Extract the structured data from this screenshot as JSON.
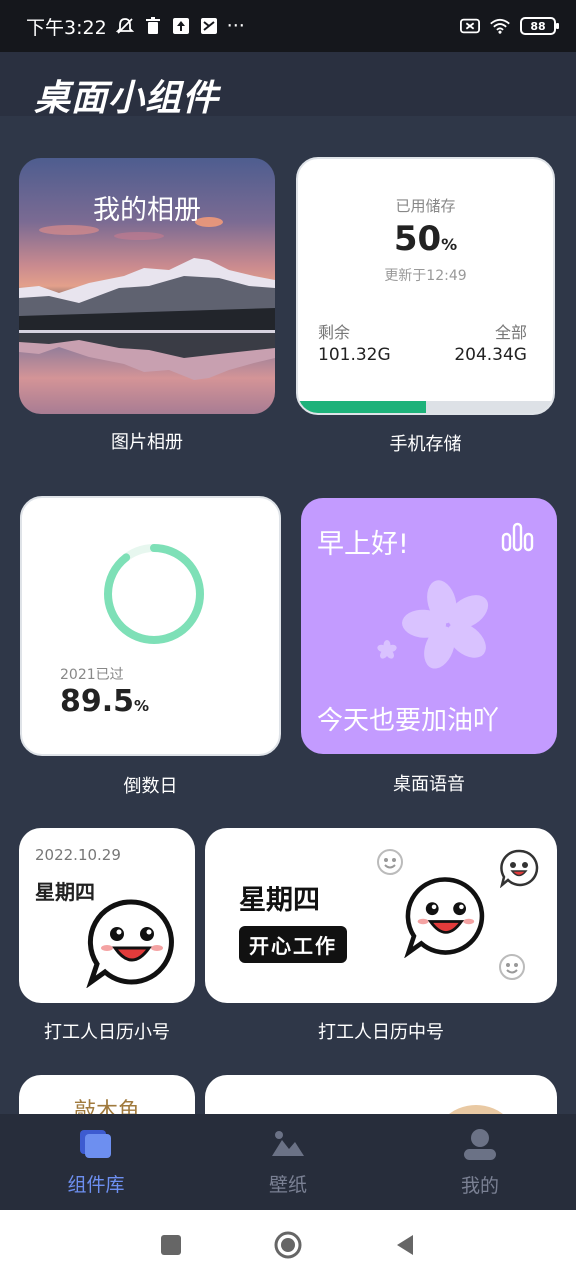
{
  "status_bar": {
    "time": "下午3:22",
    "overflow": "···",
    "battery": "88",
    "icons": [
      "silent-icon",
      "trash-icon",
      "upload-icon",
      "app-icon",
      "sim-off-icon",
      "wifi-icon",
      "battery-icon"
    ]
  },
  "header": {
    "title": "桌面小组件"
  },
  "widgets": {
    "album": {
      "title": "我的相册",
      "caption": "图片相册"
    },
    "storage": {
      "label": "已用储存",
      "percent": "50",
      "percent_unit": "%",
      "updated": "更新于12:49",
      "remaining_label": "剩余",
      "remaining_value": "101.32G",
      "total_label": "全部",
      "total_value": "204.34G",
      "used_fraction": 0.5,
      "caption": "手机存储"
    },
    "countdown": {
      "label": "2021已过",
      "value": "89.5",
      "unit": "%",
      "progress_fraction": 0.895,
      "caption": "倒数日"
    },
    "voice": {
      "greeting": "早上好!",
      "message": "今天也要加油吖",
      "caption": "桌面语音"
    },
    "calendar_small": {
      "date": "2022.10.29",
      "weekday": "星期四",
      "caption": "打工人日历小号"
    },
    "calendar_medium": {
      "weekday": "星期四",
      "tag": "开心工作",
      "caption": "打工人日历中号"
    },
    "muyu": {
      "title": "敲木鱼"
    }
  },
  "bottom_nav": {
    "items": [
      {
        "label": "组件库",
        "icon": "widgets-icon",
        "active": true
      },
      {
        "label": "壁纸",
        "icon": "wallpaper-icon",
        "active": false
      },
      {
        "label": "我的",
        "icon": "profile-icon",
        "active": false
      }
    ]
  },
  "colors": {
    "background": "#2f3748",
    "accent": "#6d8ff0",
    "storage_bar": "#1db27a",
    "countdown_ring": "#7ee0b7",
    "voice_card": "#c39bff"
  }
}
